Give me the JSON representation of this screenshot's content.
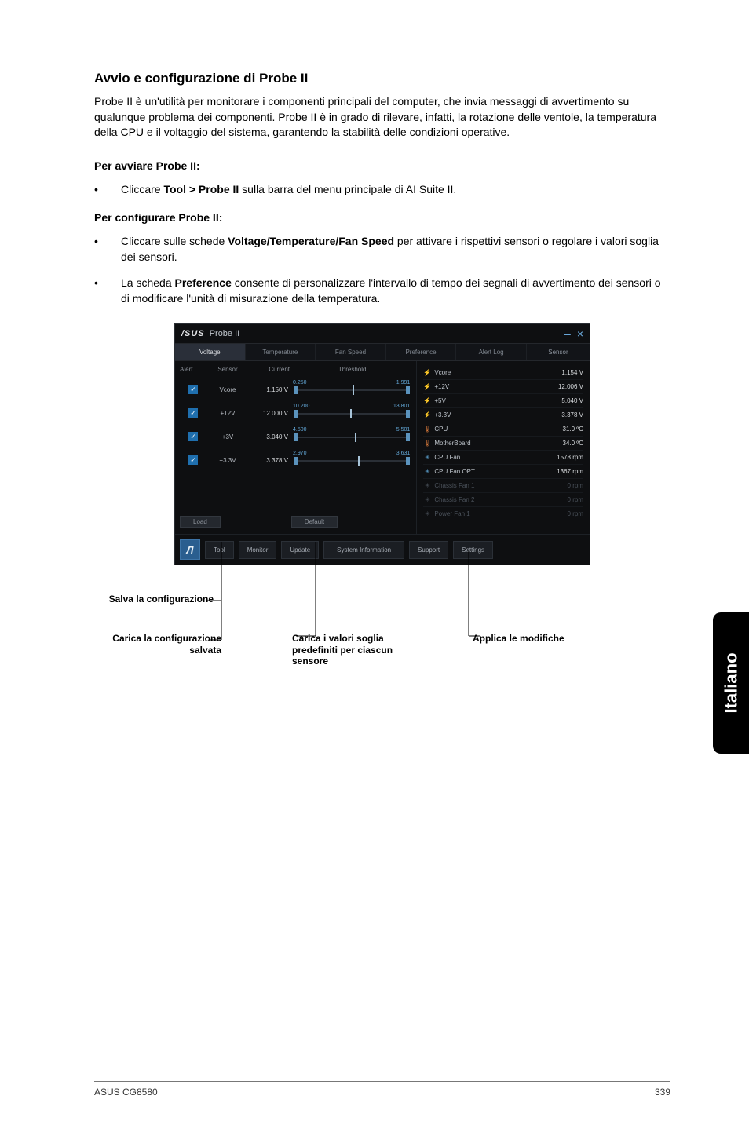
{
  "doc": {
    "heading": "Avvio e configurazione di Probe II",
    "intro": "Probe II è un'utilità per monitorare i componenti principali del computer, che invia messaggi di avvertimento su qualunque problema dei componenti. Probe II è in grado di rilevare, infatti, la rotazione delle ventole, la temperatura della CPU e il voltaggio del sistema, garantendo la stabilità delle condizioni operative.",
    "start_label": "Per avviare Probe II:",
    "start_bullet_pre": "Cliccare ",
    "start_bullet_bold": "Tool > Probe II",
    "start_bullet_post": " sulla barra del menu principale di AI Suite II.",
    "config_label": "Per configurare Probe II:",
    "config_b1_pre": "Cliccare sulle schede ",
    "config_b1_bold": "Voltage/Temperature/Fan Speed",
    "config_b1_post": " per attivare i rispettivi sensori o regolare i valori soglia dei sensori.",
    "config_b2_pre": "La scheda ",
    "config_b2_bold": "Preference",
    "config_b2_post": " consente di personalizzare l'intervallo di tempo dei segnali di avvertimento dei sensori o di modificare l'unità di misurazione della temperatura."
  },
  "probe": {
    "brand": "/SUS",
    "title": "Probe II",
    "tabs": {
      "voltage": "Voltage",
      "temperature": "Temperature",
      "fan_speed": "Fan Speed",
      "preference": "Preference",
      "alert_log": "Alert Log",
      "sensor": "Sensor"
    },
    "cols": {
      "alert": "Alert",
      "sensor": "Sensor",
      "current": "Current",
      "threshold": "Threshold"
    },
    "rows": [
      {
        "name": "Vcore",
        "current": "1.150 V",
        "low": "0.250",
        "high": "1.991"
      },
      {
        "name": "+12V",
        "current": "12.000 V",
        "low": "10.200",
        "high": "13.801"
      },
      {
        "name": "+3V",
        "current": "3.040 V",
        "low": "4.500",
        "high": "5.501"
      },
      {
        "name": "+3.3V",
        "current": "3.378 V",
        "low": "2.970",
        "high": "3.631"
      }
    ],
    "metrics": [
      {
        "icon": "volt",
        "name": "Vcore",
        "value": "1.154 V"
      },
      {
        "icon": "volt",
        "name": "+12V",
        "value": "12.006 V"
      },
      {
        "icon": "volt",
        "name": "+5V",
        "value": "5.040 V"
      },
      {
        "icon": "volt",
        "name": "+3.3V",
        "value": "3.378 V"
      },
      {
        "icon": "temp",
        "name": "CPU",
        "value": "31.0 ºC"
      },
      {
        "icon": "temp",
        "name": "MotherBoard",
        "value": "34.0 ºC"
      },
      {
        "icon": "fan",
        "name": "CPU Fan",
        "value": "1578 rpm"
      },
      {
        "icon": "fan",
        "name": "CPU Fan OPT",
        "value": "1367 rpm"
      }
    ],
    "dim_metrics": [
      {
        "name": "Chassis Fan 1",
        "value": "0 rpm"
      },
      {
        "name": "Chassis Fan 2",
        "value": "0 rpm"
      },
      {
        "name": "Power Fan 1",
        "value": "0 rpm"
      }
    ],
    "bottom": {
      "load": "Load",
      "default": "Default"
    },
    "footer": {
      "tool": "Tool",
      "monitor": "Monitor",
      "update": "Update",
      "sysinfo": "System Information",
      "support": "Support",
      "settings": "Settings"
    }
  },
  "annotations": {
    "salva": "Salva la configurazione",
    "carica": "Carica la configurazione salvata",
    "predef": "Carica i valori soglia predefiniti per ciascun sensore",
    "applica": "Applica le modifiche"
  },
  "side_tab": "Italiano",
  "footer": {
    "left": "ASUS CG8580",
    "right": "339"
  }
}
